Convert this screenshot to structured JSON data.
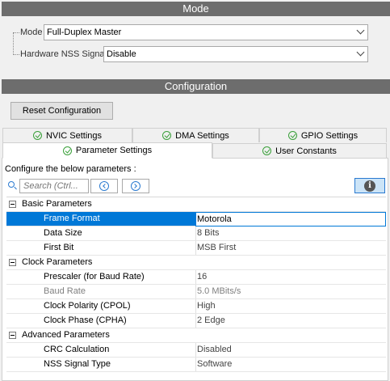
{
  "mode": {
    "title": "Mode",
    "mode_label": "Mode",
    "mode_value": "Full-Duplex Master",
    "nss_label": "Hardware NSS Signal",
    "nss_value": "Disable"
  },
  "configuration": {
    "title": "Configuration",
    "reset_label": "Reset Configuration",
    "tabs_row1": [
      {
        "label": "NVIC Settings"
      },
      {
        "label": "DMA Settings"
      },
      {
        "label": "GPIO Settings"
      }
    ],
    "tabs_row2": [
      {
        "label": "Parameter Settings",
        "active": true
      },
      {
        "label": "User Constants"
      }
    ],
    "panel_caption": "Configure the below parameters :",
    "search_placeholder": "Search (Ctrl...",
    "groups": [
      {
        "name": "Basic Parameters",
        "params": [
          {
            "name": "Frame Format",
            "value": "Motorola",
            "selected": true
          },
          {
            "name": "Data Size",
            "value": "8 Bits"
          },
          {
            "name": "First Bit",
            "value": "MSB First"
          }
        ]
      },
      {
        "name": "Clock Parameters",
        "params": [
          {
            "name": "Prescaler (for Baud Rate)",
            "value": "16"
          },
          {
            "name": "Baud Rate",
            "value": "5.0 MBits/s",
            "disabled": true
          },
          {
            "name": "Clock Polarity (CPOL)",
            "value": "High"
          },
          {
            "name": "Clock Phase (CPHA)",
            "value": "2 Edge"
          }
        ]
      },
      {
        "name": "Advanced Parameters",
        "params": [
          {
            "name": "CRC Calculation",
            "value": "Disabled"
          },
          {
            "name": "NSS Signal Type",
            "value": "Software"
          }
        ]
      }
    ]
  },
  "colors": {
    "section_bar": "#6d6d6d",
    "selection": "#0078d7",
    "check_icon": "#3aa03a",
    "accent": "#2a7ad0"
  }
}
